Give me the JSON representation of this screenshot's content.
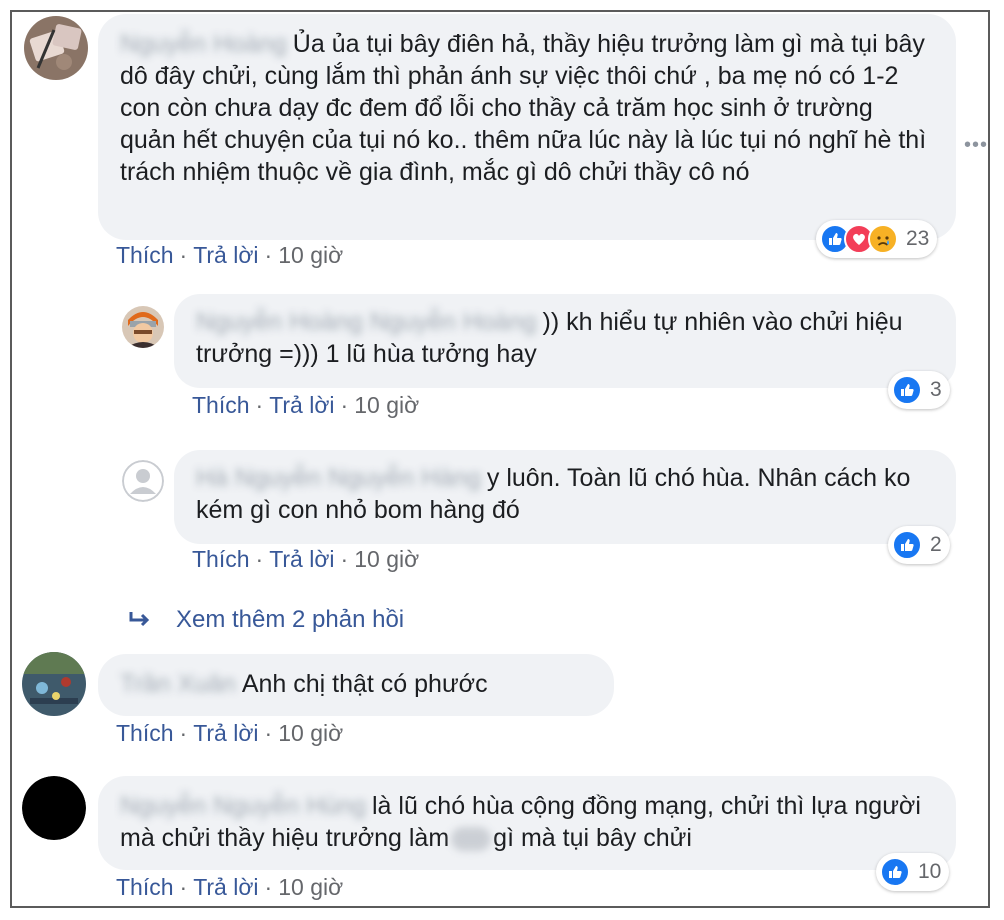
{
  "comments": [
    {
      "name": "Nguyễn Hoàng",
      "text": "Ủa ủa tụi bây điên hả, thầy hiệu trưởng làm gì mà tụi bây dô đây chửi, cùng lắm thì phản ánh sự việc thôi chứ , ba mẹ nó có 1-2 con còn chưa dạy đc đem đổ lỗi cho thầy cả trăm học sinh ở trường quản hết chuyện của tụi nó ko.. thêm nữa lúc này là lúc tụi nó nghĩ hè thì trách nhiệm thuộc về gia đình, mắc gì dô chửi thầy cô nó",
      "like": "Thích",
      "reply": "Trả lời",
      "time": "10 giờ",
      "reaction_count": "23"
    },
    {
      "name": "Nguyễn Hoàng Nguyễn Hoàng",
      "text": ")) kh hiểu tự nhiên vào chửi hiệu trưởng =))) 1 lũ hùa tưởng hay",
      "like": "Thích",
      "reply": "Trả lời",
      "time": "10 giờ",
      "reaction_count": "3"
    },
    {
      "name": "Hà Nguyễn Nguyễn Hàng",
      "text": "y luôn. Toàn lũ chó hùa. Nhân cách ko kém gì con nhỏ bom hàng đó",
      "like": "Thích",
      "reply": "Trả lời",
      "time": "10 giờ",
      "reaction_count": "2"
    },
    {
      "name": "Trần Xuân",
      "text": "Anh chị thật có phước",
      "like": "Thích",
      "reply": "Trả lời",
      "time": "10 giờ"
    },
    {
      "name": "Nguyễn Nguyễn Hùng",
      "text_a": "là lũ chó hùa cộng đồng mạng, chửi thì lựa người mà chửi thầy hiệu trưởng làm",
      "text_b": "gì mà tụi bây chửi",
      "like": "Thích",
      "reply": "Trả lời",
      "time": "10 giờ",
      "reaction_count": "10"
    }
  ],
  "view_more": "Xem thêm 2 phản hồi",
  "separator": "·",
  "icons": {
    "like": "like-icon",
    "love": "love-icon",
    "sad": "sad-icon",
    "reply_arrow": "reply-arrow-icon",
    "more": "more-options-icon"
  },
  "colors": {
    "link": "#385898",
    "like_blue": "#1877f2",
    "love_red": "#f33e58",
    "bubble": "#f0f2f5"
  }
}
